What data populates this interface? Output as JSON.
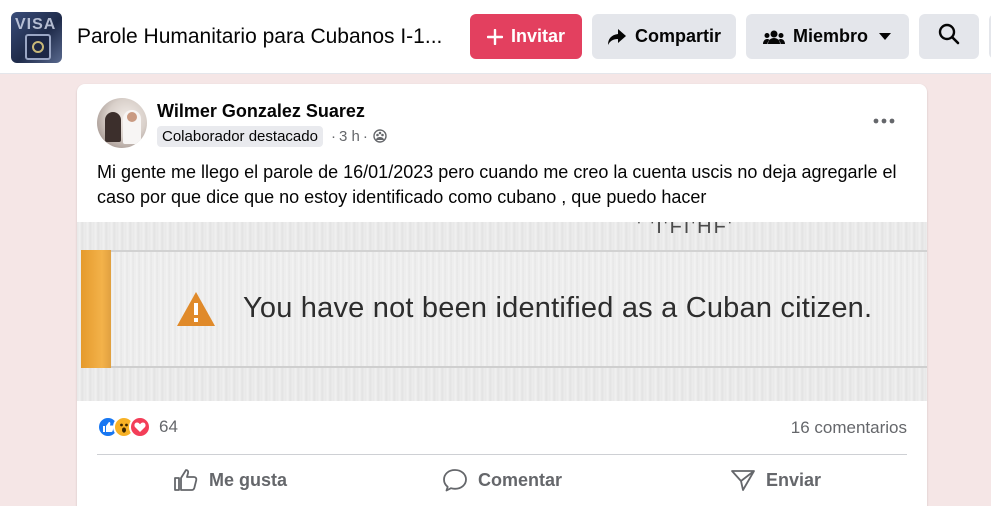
{
  "header": {
    "group_title": "Parole Humanitario para Cubanos I-1...",
    "thumb_text": "VISA",
    "invite_label": "Invitar",
    "share_label": "Compartir",
    "member_label": "Miembro",
    "accent_color": "#e3405f"
  },
  "post": {
    "author": "Wilmer Gonzalez Suarez",
    "badge": "Colaborador destacado",
    "time": "3 h",
    "text": "Mi gente me llego el parole de 16/01/2023 pero cuando me creo la cuenta uscis no deja agregarle el caso por que dice que no estoy identificado como cubano , que puedo hacer",
    "image": {
      "message": "You have not been identified as a Cuban citizen.",
      "top_fragment": "' 'I'FI'HF'"
    },
    "reactions": {
      "types": [
        "like-icon",
        "wow-icon",
        "love-icon"
      ],
      "count": "64"
    },
    "comments": "16 comentarios",
    "actions": {
      "like": "Me gusta",
      "comment": "Comentar",
      "send": "Enviar"
    }
  }
}
